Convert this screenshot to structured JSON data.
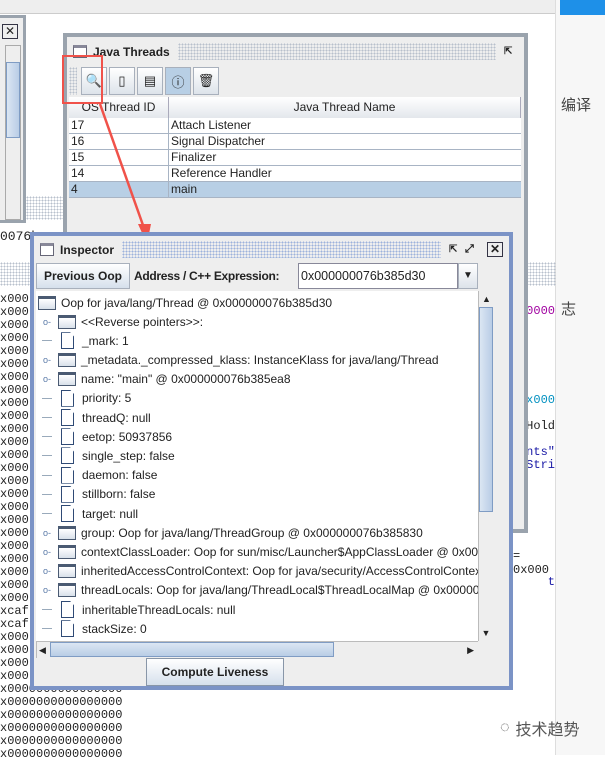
{
  "background": {
    "left_hex_lines": [
      "x000",
      "x000",
      "x000",
      "x000",
      "x000",
      "x000",
      "x000",
      "x000",
      "x000",
      "x000",
      "x000",
      "x000",
      "x000",
      "x000",
      "x000",
      "x000",
      "x000",
      "x000",
      "x000",
      "x000",
      "x000",
      "x000",
      "x000",
      "x000",
      "xcaf",
      "xcaf",
      "x000",
      "x000",
      "x000",
      "x000",
      "x0000000000000000",
      "x0000000000000000",
      "x0000000000000000",
      "x0000000000000000",
      "x0000000000000000",
      "x0000000000000000"
    ],
    "left_field_fragment": "0076b",
    "right_chinese_1": "编译",
    "right_chinese_2": "志",
    "right_code": [
      {
        "text": "00000",
        "color": "#a000a0"
      },
      {
        "text": "0x000",
        "color": "#0090c0"
      },
      {
        "text": "tHold",
        "color": "#222222"
      },
      {
        "text": "ints\"",
        "color": "#1a1aa6"
      },
      {
        "text": "/Stri",
        "color": "#1a1aa6"
      },
      {
        "text": "= 0x000",
        "color": "#222222"
      },
      {
        "text": "t",
        "color": "#1a1aa6"
      }
    ],
    "watermark": "技术趋势"
  },
  "java_threads": {
    "title": "Java Threads",
    "toolbar": [
      {
        "icon": "inspect-magnifier-icon",
        "selected": false
      },
      {
        "icon": "stack-memory-icon",
        "selected": false
      },
      {
        "icon": "thread-stack-icon",
        "selected": false
      },
      {
        "icon": "thread-info-icon",
        "selected": true
      },
      {
        "icon": "trash-icon",
        "selected": false
      }
    ],
    "columns": [
      "OS Thread ID",
      "Java Thread Name"
    ],
    "rows": [
      {
        "id": "17",
        "name": "Attach Listener"
      },
      {
        "id": "16",
        "name": "Signal Dispatcher"
      },
      {
        "id": "15",
        "name": "Finalizer"
      },
      {
        "id": "14",
        "name": "Reference Handler"
      },
      {
        "id": "4",
        "name": "main",
        "selected": true
      }
    ]
  },
  "inspector": {
    "title": "Inspector",
    "previous_oop": "Previous Oop",
    "address_label": "Address / C++ Expression:",
    "address_value": "0x000000076b385d30",
    "root": "Oop for java/lang/Thread @ 0x000000076b385d30",
    "tree": [
      {
        "type": "folder",
        "text": "<<Reverse pointers>>:"
      },
      {
        "type": "file",
        "text": "_mark: 1"
      },
      {
        "type": "folder",
        "text": "_metadata._compressed_klass: InstanceKlass for java/lang/Thread"
      },
      {
        "type": "folder",
        "text": "name: \"main\" @ 0x000000076b385ea8"
      },
      {
        "type": "file",
        "text": "priority: 5"
      },
      {
        "type": "file",
        "text": "threadQ: null"
      },
      {
        "type": "file",
        "text": "eetop: 50937856"
      },
      {
        "type": "file",
        "text": "single_step: false"
      },
      {
        "type": "file",
        "text": "daemon: false"
      },
      {
        "type": "file",
        "text": "stillborn: false"
      },
      {
        "type": "file",
        "text": "target: null"
      },
      {
        "type": "folder",
        "text": "group: Oop for java/lang/ThreadGroup @ 0x000000076b385830"
      },
      {
        "type": "folder",
        "text": "contextClassLoader: Oop for sun/misc/Launcher$AppClassLoader @ 0x000"
      },
      {
        "type": "folder",
        "text": "inheritedAccessControlContext: Oop for java/security/AccessControlContext @"
      },
      {
        "type": "folder",
        "text": "threadLocals: Oop for java/lang/ThreadLocal$ThreadLocalMap @ 0x0000000"
      },
      {
        "type": "file",
        "text": "inheritableThreadLocals: null"
      },
      {
        "type": "file",
        "text": "stackSize: 0"
      }
    ],
    "compute_liveness": "Compute Liveness"
  },
  "annotation_color": "#f0524a"
}
